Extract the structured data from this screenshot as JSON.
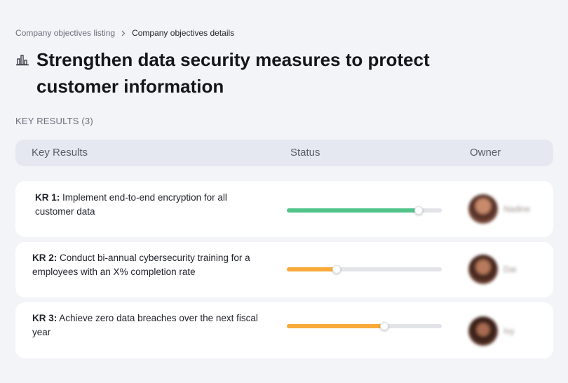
{
  "breadcrumb": {
    "parent": "Company objectives listing",
    "current": "Company objectives details"
  },
  "title": {
    "icon": "chart-building-icon",
    "text": "Strengthen data security measures to protect customer information"
  },
  "key_results_count": "KEY RESULTS (3)",
  "table_header": {
    "key_results": "Key Results",
    "status": "Status",
    "owner": "Owner"
  },
  "key_results": [
    {
      "label": "KR 1:",
      "text": " Implement end-to-end encryption for all customer data",
      "progress": 0.85,
      "color": "#52c48b",
      "owner_name": "Nadine"
    },
    {
      "label": "KR 2:",
      "text": " Conduct bi-annual cybersecurity training for a employees with an X% completion rate",
      "progress": 0.32,
      "color": "#f8aa3a",
      "owner_name": "Dai"
    },
    {
      "label": "KR 3:",
      "text": " Achieve zero data breaches over the next fiscal year",
      "progress": 0.63,
      "color": "#f8aa3a",
      "owner_name": "Ivy"
    }
  ]
}
